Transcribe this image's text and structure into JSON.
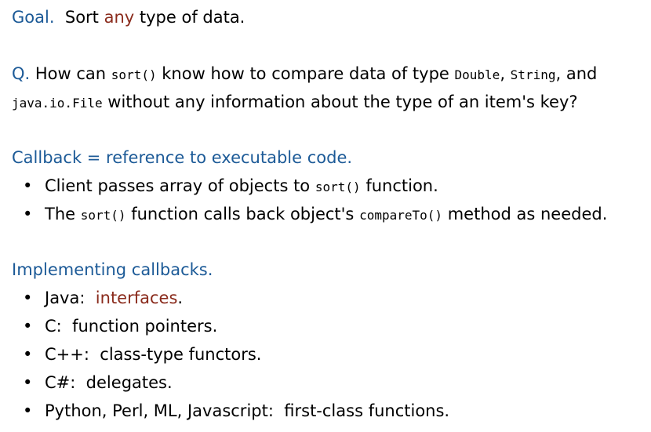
{
  "goal": {
    "heading": "Goal.",
    "text_before": "Sort ",
    "highlight": "any",
    "text_after": " type of data."
  },
  "question": {
    "heading": "Q.",
    "line1_a": " How can ",
    "line1_code1": "sort()",
    "line1_b": " know how to compare data of type ",
    "line1_code2": "Double",
    "line1_c": ", ",
    "line1_code3": "String",
    "line1_d": ", and",
    "line2_code": "java.io.File",
    "line2_text": " without any information about the type of an item's key?"
  },
  "callback": {
    "heading": "Callback = reference to executable code.",
    "bullet": "•",
    "item1_a": "Client passes array of objects to ",
    "item1_code": "sort()",
    "item1_b": " function.",
    "item2_a": "The ",
    "item2_code1": "sort()",
    "item2_b": " function calls back object's ",
    "item2_code2": "compareTo()",
    "item2_c": " method as needed."
  },
  "implementing": {
    "heading": "Implementing callbacks.",
    "bullet": "•",
    "java_label": "Java:  ",
    "java_value": "interfaces",
    "java_period": ".",
    "items": [
      "C:  function pointers.",
      "C++:  class-type functors.",
      "C#:  delegates.",
      "Python, Perl, ML, Javascript:  first-class functions."
    ]
  },
  "colors": {
    "heading_blue": "#1c5a97",
    "highlight_red": "#8a2b1c"
  }
}
